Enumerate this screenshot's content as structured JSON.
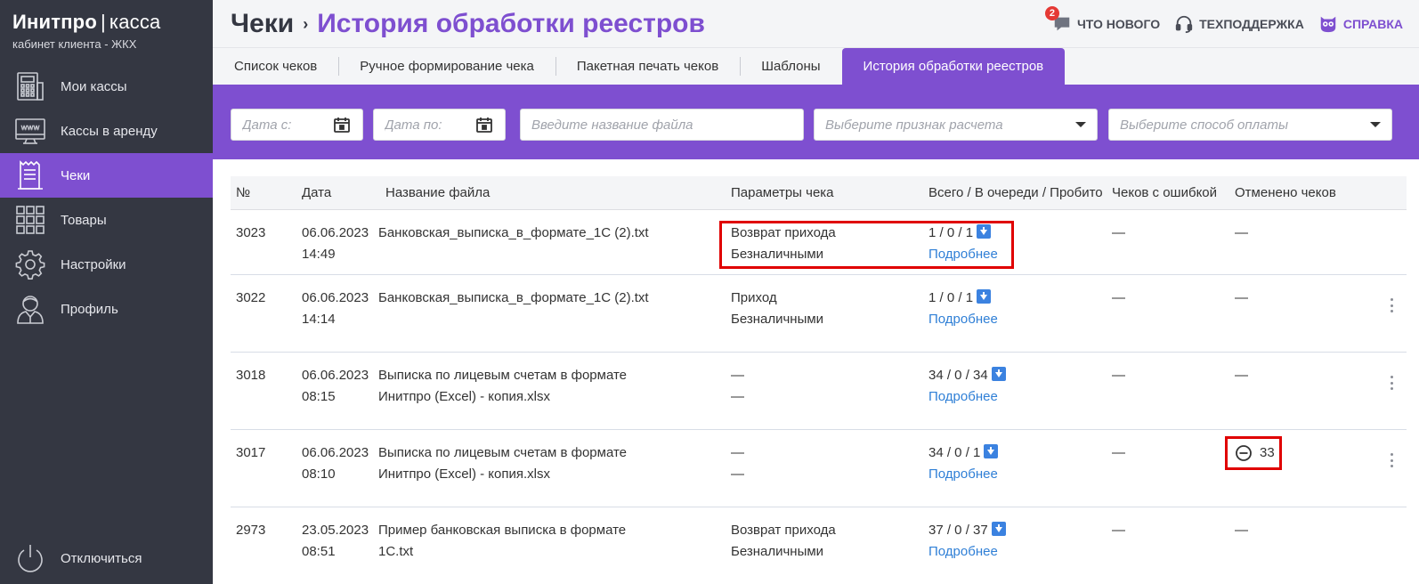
{
  "brand": {
    "name": "Инитпро",
    "product": "касса",
    "subtitle": "кабинет клиента - ЖКХ"
  },
  "sidebar": {
    "items": [
      {
        "label": "Мои кассы",
        "icon": "cash-register-icon",
        "active": false
      },
      {
        "label": "Кассы в аренду",
        "icon": "www-monitor-icon",
        "active": false
      },
      {
        "label": "Чеки",
        "icon": "receipt-icon",
        "active": true
      },
      {
        "label": "Товары",
        "icon": "grid-icon",
        "active": false
      },
      {
        "label": "Настройки",
        "icon": "gear-icon",
        "active": false
      },
      {
        "label": "Профиль",
        "icon": "user-icon",
        "active": false
      }
    ],
    "logout": {
      "label": "Отключиться",
      "icon": "power-icon"
    }
  },
  "header": {
    "crumb_parent": "Чеки",
    "crumb_current": "История обработки реестров",
    "links": {
      "news": "ЧТО НОВОГО",
      "news_badge": "2",
      "support": "ТЕХПОДДЕРЖКА",
      "help": "СПРАВКА"
    }
  },
  "tabs": [
    {
      "label": "Список чеков",
      "active": false
    },
    {
      "label": "Ручное формирование чека",
      "active": false
    },
    {
      "label": "Пакетная печать чеков",
      "active": false
    },
    {
      "label": "Шаблоны",
      "active": false
    },
    {
      "label": "История обработки реестров",
      "active": true
    }
  ],
  "filters": {
    "date_from_placeholder": "Дата с:",
    "date_to_placeholder": "Дата по:",
    "file_placeholder": "Введите название файла",
    "payment_sign_placeholder": "Выберите признак расчета",
    "payment_method_placeholder": "Выберите способ оплаты"
  },
  "table": {
    "headers": {
      "num": "№",
      "date": "Дата",
      "file": "Название файла",
      "params": "Параметры чека",
      "total": "Всего / В очереди / Пробито",
      "errors": "Чеков с ошибкой",
      "cancelled": "Отменено чеков"
    },
    "more_label": "Подробнее",
    "rows": [
      {
        "num": "3023",
        "date": "06.06.2023",
        "time": "14:49",
        "file1": "Банковская_выписка_в_формате_1С (2).txt",
        "file2": "",
        "param1": "Возврат прихода",
        "param2": "Безналичными",
        "total": "1 / 0 / 1",
        "errors": "—",
        "cancelled": "—"
      },
      {
        "num": "3022",
        "date": "06.06.2023",
        "time": "14:14",
        "file1": "Банковская_выписка_в_формате_1С (2).txt",
        "file2": "",
        "param1": "Приход",
        "param2": "Безналичными",
        "total": "1 / 0 / 1",
        "errors": "—",
        "cancelled": "—"
      },
      {
        "num": "3018",
        "date": "06.06.2023",
        "time": "08:15",
        "file1": "Выписка по лицевым счетам в формате",
        "file2": "Инитпро (Excel) - копия.xlsx",
        "param1": "—",
        "param2": "—",
        "total": "34 / 0 / 34",
        "errors": "—",
        "cancelled": "—"
      },
      {
        "num": "3017",
        "date": "06.06.2023",
        "time": "08:10",
        "file1": "Выписка по лицевым счетам в формате",
        "file2": "Инитпро (Excel) - копия.xlsx",
        "param1": "—",
        "param2": "—",
        "total": "34 / 0 / 1",
        "errors": "—",
        "cancelled": "33"
      },
      {
        "num": "2973",
        "date": "23.05.2023",
        "time": "08:51",
        "file1": "Пример банковская выписка в формате",
        "file2": "1С.txt",
        "param1": "Возврат прихода",
        "param2": "Безналичными",
        "total": "37 / 0 / 37",
        "errors": "—",
        "cancelled": "—"
      }
    ]
  },
  "colors": {
    "accent": "#7e4fd0",
    "sidebar": "#343742",
    "link": "#2f7fd6",
    "highlight": "#e00000"
  }
}
